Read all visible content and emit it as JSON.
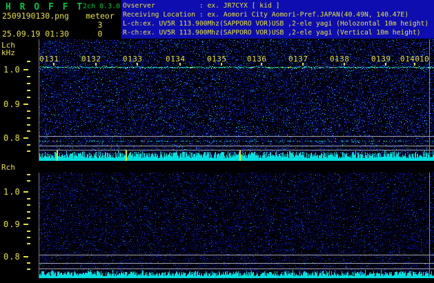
{
  "app": {
    "logo_text": "H R O F F T",
    "version": "2ch 0.3.0",
    "mode": "meteor"
  },
  "header": {
    "filename": "2509190130.png",
    "datetime": "25.09.19 01:30",
    "lch_meteor_count": "3",
    "rch_meteor_count": "0",
    "info_lines": [
      "Ovserver           : ex. JR7CYX [ kid ]",
      "Receiving Location : ex. Aomori City Aomori-Pref.JAPAN(40.49N, 140.47E)",
      "L-ch:ex. UV5R 113.900Mhz(SAPPORO VOR)USB ,2-ele yagi (Holozontal 10m height)",
      "R-ch:ex. UV5R 113.900Mhz(SAPPORO VOR)USB ,2-ele yagi (Vertical 10m height)"
    ]
  },
  "time_axis": {
    "labels": [
      "0131",
      "0132",
      "0133",
      "0134",
      "0135",
      "0136",
      "0137",
      "0138",
      "0139",
      "0140"
    ],
    "partial_right_label": "10"
  },
  "panels": [
    {
      "id": "lch",
      "label": "Lch",
      "unit": "kHz",
      "freq_labels": [
        "1.0",
        "0.9",
        "0.8"
      ],
      "carrier_freq_khz": "1.0",
      "has_carrier_line": true,
      "detection_spikes": 3
    },
    {
      "id": "rch",
      "label": "Rch",
      "unit": "",
      "freq_labels": [
        "1.0",
        "0.9",
        "0.8"
      ],
      "has_carrier_line": false,
      "detection_spikes": 0
    }
  ],
  "colors": {
    "background": "#000000",
    "text_yellow": "#e8e23c",
    "logo_green": "#00c83c",
    "info_bg_blue": "#0d0db0",
    "noise_blue": "#0018a0",
    "signal_cyan": "#00e0e0",
    "marker_yellow": "#f0f000",
    "grid_gray": "#a0a4ac"
  }
}
